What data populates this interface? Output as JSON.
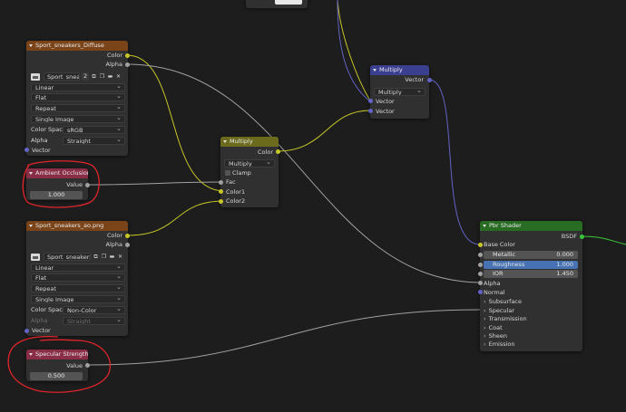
{
  "colors": {
    "background": "#1d1d1d",
    "node_body": "#303030",
    "header_image": "#7a4418",
    "header_math": "#6b6a1d",
    "header_vector": "#3b3f8f",
    "header_shader": "#286c23",
    "header_value": "#8a2d47",
    "socket_color": "#c7c729",
    "socket_float": "#a1a1a1",
    "socket_vector": "#6363c7",
    "socket_shader": "#39c739",
    "annotation": "#e0252b"
  },
  "tex_diffuse": {
    "title": "Sport_sneakers_Diffuse",
    "out_color": "Color",
    "out_alpha": "Alpha",
    "image_name": "Sport_sneak...",
    "users": "2",
    "interpolation": "Linear",
    "projection": "Flat",
    "extension": "Repeat",
    "source": "Single Image",
    "colorspace_label": "Color Space",
    "colorspace": "sRGB",
    "alpha_label": "Alpha",
    "alpha_mode": "Straight",
    "in_vector": "Vector"
  },
  "ao_value": {
    "title": "Ambient Occlusion...",
    "out_label": "Value",
    "value": "1.000"
  },
  "tex_ao": {
    "title": "Sport_sneakers_ao.png",
    "out_color": "Color",
    "out_alpha": "Alpha",
    "image_name": "Sport_sneakers...",
    "interpolation": "Linear",
    "projection": "Flat",
    "extension": "Repeat",
    "source": "Single Image",
    "colorspace_label": "Color Space",
    "colorspace": "Non-Color",
    "alpha_label": "Alpha",
    "alpha_mode": "Straight",
    "in_vector": "Vector"
  },
  "spec_value": {
    "title": "Specular Strength",
    "out_label": "Value",
    "value": "0.500"
  },
  "mix_multiply": {
    "title": "Multiply",
    "out_color": "Color",
    "mode": "Multiply",
    "clamp": "Clamp",
    "in_fac": "Fac",
    "in_color1": "Color1",
    "in_color2": "Color2"
  },
  "vec_multiply": {
    "title": "Multiply",
    "out_vector": "Vector",
    "mode": "Multiply",
    "in_vector1": "Vector",
    "in_vector2": "Vector"
  },
  "pbr": {
    "title": "Pbr Shader",
    "out_bsdf": "BSDF",
    "base_color": "Base Color",
    "metallic_label": "Metallic",
    "metallic": "0.000",
    "roughness_label": "Roughness",
    "roughness": "1.000",
    "ior_label": "IOR",
    "ior": "1.450",
    "alpha": "Alpha",
    "normal": "Normal",
    "panels": [
      "Subsurface",
      "Specular",
      "Transmission",
      "Coat",
      "Sheen",
      "Emission"
    ]
  }
}
